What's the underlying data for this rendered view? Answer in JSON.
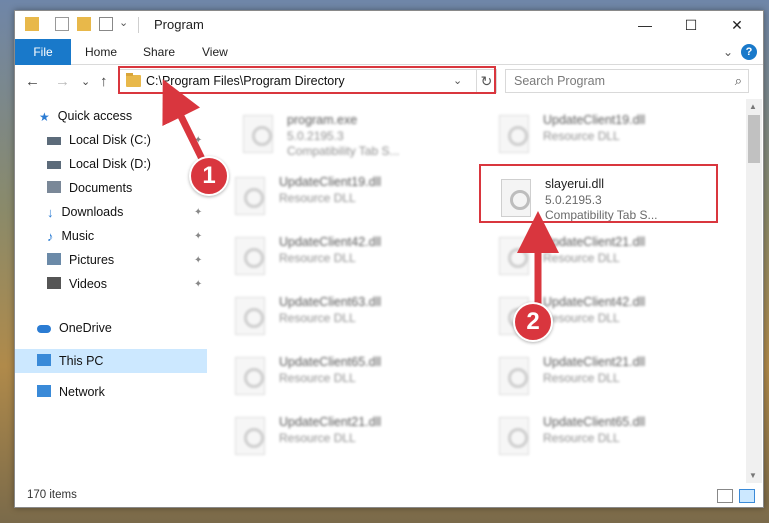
{
  "window": {
    "title": "Program",
    "controls": {
      "minimize": "—",
      "maximize": "☐",
      "close": "✕"
    }
  },
  "ribbon": {
    "tabs": [
      "File",
      "Home",
      "Share",
      "View"
    ],
    "chevron": "⌄",
    "help": "?"
  },
  "nav": {
    "back": "←",
    "forward": "→",
    "up_list": "⌄",
    "up": "↑",
    "address": "C:\\Program Files\\Program Directory",
    "address_chevron": "⌄",
    "refresh": "↻",
    "search_placeholder": "Search Program",
    "search_icon": "⌕"
  },
  "sidebar": {
    "items": [
      {
        "label": "Quick access",
        "icon": "star-icon",
        "color": "#2b7cd3"
      },
      {
        "label": "Local Disk (C:)",
        "icon": "drive-icon",
        "color": "#5c6b7a",
        "pinned": true
      },
      {
        "label": "Local Disk (D:)",
        "icon": "drive-icon",
        "color": "#5c6b7a",
        "pinned": true
      },
      {
        "label": "Documents",
        "icon": "documents-icon",
        "color": "#7a8898",
        "pinned": true
      },
      {
        "label": "Downloads",
        "icon": "download-icon",
        "color": "#2b7cd3",
        "pinned": true
      },
      {
        "label": "Music",
        "icon": "music-icon",
        "color": "#2b7cd3",
        "pinned": true
      },
      {
        "label": "Pictures",
        "icon": "pictures-icon",
        "color": "#6b8aa8",
        "pinned": true
      },
      {
        "label": "Videos",
        "icon": "videos-icon",
        "color": "#555555",
        "pinned": true
      },
      {
        "label": "OneDrive",
        "icon": "cloud-icon",
        "color": "#2b7cd3"
      },
      {
        "label": "This PC",
        "icon": "pc-icon",
        "color": "#3a8ad8",
        "selected": true
      },
      {
        "label": "Network",
        "icon": "network-icon",
        "color": "#3a8ad8"
      }
    ],
    "pin_glyph": "📌"
  },
  "files": {
    "left": [
      {
        "name": "program.exe",
        "sub": "5.0.2195.3",
        "sub2": "Compatibility Tab S..."
      },
      {
        "name": "UpdateClient19.dll",
        "sub": "Resource DLL"
      },
      {
        "name": "UpdateClient42.dll",
        "sub": "Resource DLL"
      },
      {
        "name": "UpdateClient63.dll",
        "sub": "Resource DLL"
      },
      {
        "name": "UpdateClient65.dll",
        "sub": "Resource DLL"
      },
      {
        "name": "UpdateClient21.dll",
        "sub": "Resource DLL"
      }
    ],
    "right": [
      {
        "name": "UpdateClient19.dll",
        "sub": "Resource DLL"
      },
      {
        "name": "slayerui.dll",
        "sub": "5.0.2195.3",
        "sub2": "Compatibility Tab S...",
        "highlight": true
      },
      {
        "name": "UpdateClient21.dll",
        "sub": "Resource DLL"
      },
      {
        "name": "UpdateClient42.dll",
        "sub": "Resource DLL"
      },
      {
        "name": "UpdateClient21.dll",
        "sub": "Resource DLL"
      },
      {
        "name": "UpdateClient65.dll",
        "sub": "Resource DLL"
      }
    ]
  },
  "status": {
    "items_count": "170 items"
  },
  "annotations": {
    "step1": "1",
    "step2": "2",
    "color": "#d9363e"
  }
}
